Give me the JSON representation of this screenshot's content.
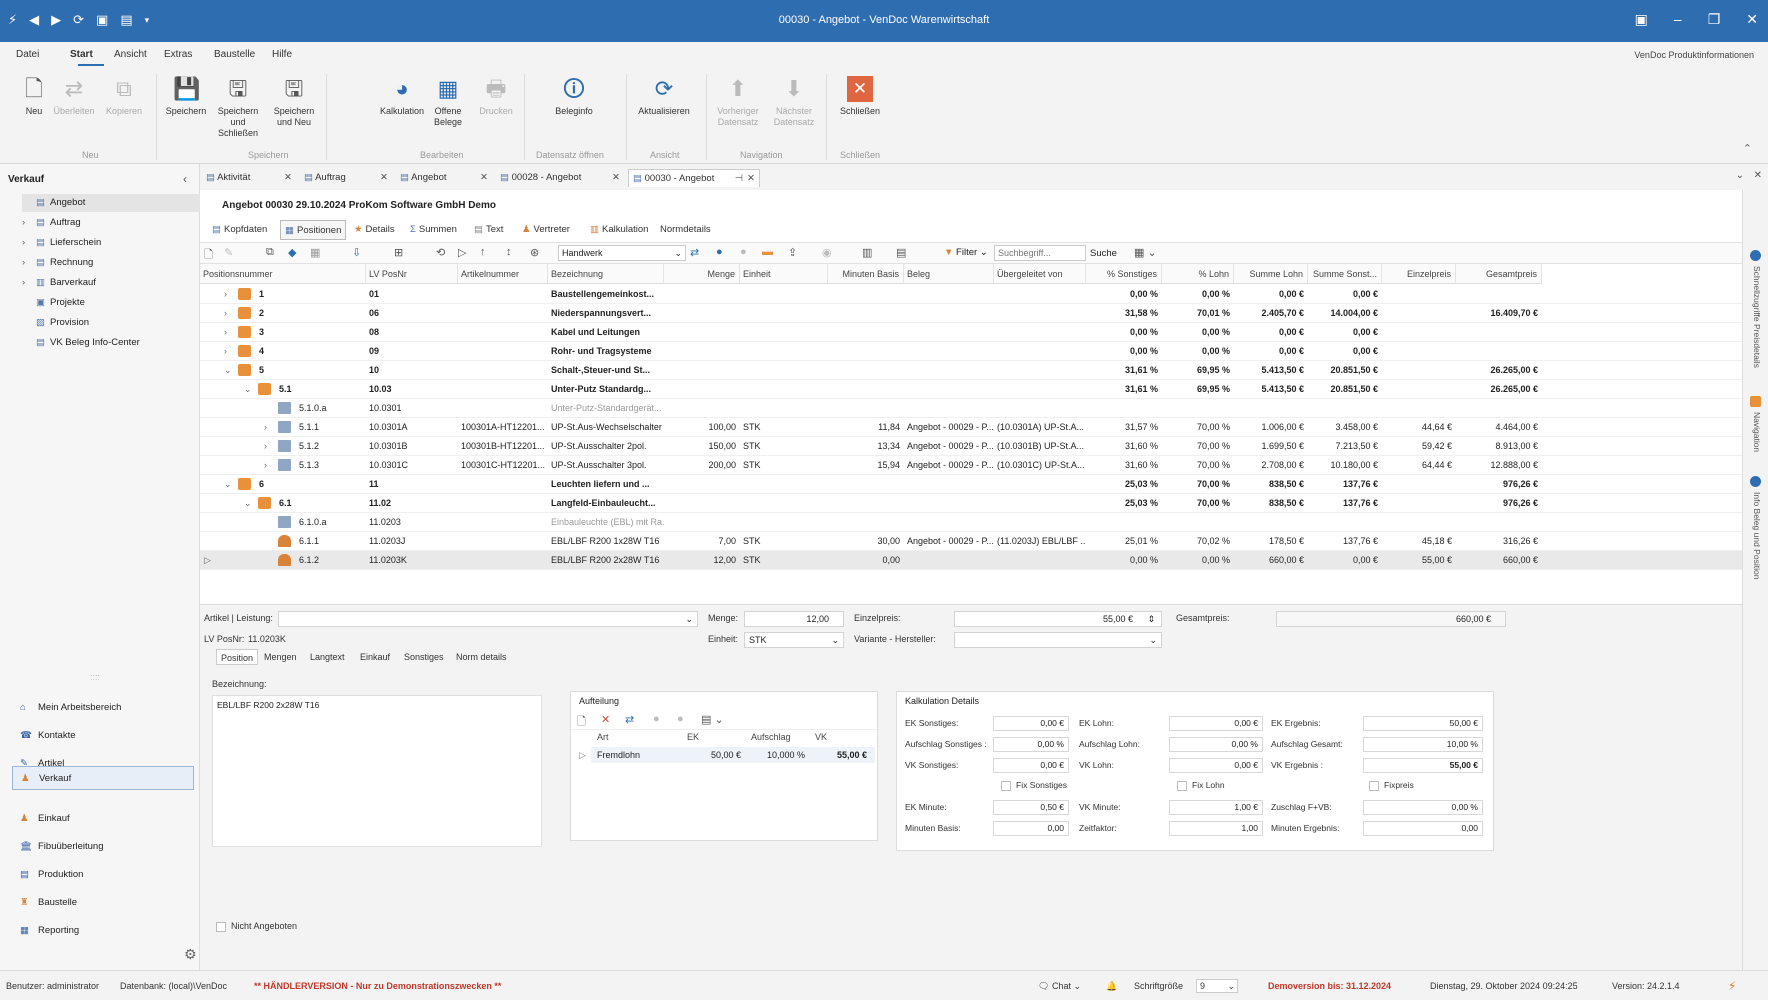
{
  "window": {
    "title": "00030 - Angebot - VenDoc Warenwirtschaft",
    "icons": [
      "app-icon",
      "back-icon",
      "forward-icon",
      "refresh-icon",
      "save-icon",
      "layout-icon",
      "dropdown-icon"
    ],
    "controls": [
      "layout-icon",
      "minimize-icon",
      "restore-icon",
      "close-icon"
    ]
  },
  "menu": {
    "items": [
      "Datei",
      "Start",
      "Ansicht",
      "Extras",
      "Baustelle",
      "Hilfe"
    ],
    "active": "Start",
    "product_info": "VenDoc Produktinformationen"
  },
  "ribbon": {
    "buttons": [
      {
        "label": "Neu",
        "icon": "new-doc-icon",
        "enabled": true
      },
      {
        "label": "Überleiten",
        "icon": "transfer-icon",
        "enabled": false
      },
      {
        "label": "Kopieren",
        "icon": "copy-icon",
        "enabled": false
      },
      {
        "label": "Speichern",
        "icon": "save-icon",
        "enabled": true
      },
      {
        "label": "Speichern und Schließen",
        "icon": "save-close-icon",
        "enabled": true
      },
      {
        "label": "Speichern und Neu",
        "icon": "save-new-icon",
        "enabled": true
      },
      {
        "label": "Kalkulation",
        "icon": "pie-chart-icon",
        "enabled": true
      },
      {
        "label": "Offene Belege",
        "icon": "open-docs-icon",
        "enabled": true
      },
      {
        "label": "Drucken",
        "icon": "print-icon",
        "enabled": false
      },
      {
        "label": "Beleginfo",
        "icon": "info-doc-icon",
        "enabled": true
      },
      {
        "label": "Aktualisieren",
        "icon": "refresh-icon",
        "enabled": true
      },
      {
        "label": "Vorheriger Datensatz",
        "icon": "up-icon",
        "enabled": false
      },
      {
        "label": "Nächster Datensatz",
        "icon": "down-icon",
        "enabled": false
      },
      {
        "label": "Schließen",
        "icon": "close-box-icon",
        "enabled": true
      }
    ],
    "groups": [
      "Neu",
      "Speichern",
      "Bearbeiten",
      "Datensatz öffnen",
      "Ansicht",
      "Navigation",
      "Schließen"
    ]
  },
  "sidebar": {
    "title": "Verkauf",
    "tree": [
      {
        "label": "Angebot",
        "selected": true,
        "expandable": false
      },
      {
        "label": "Auftrag",
        "expandable": true
      },
      {
        "label": "Lieferschein",
        "expandable": true
      },
      {
        "label": "Rechnung",
        "expandable": true
      },
      {
        "label": "Barverkauf",
        "expandable": true
      },
      {
        "label": "Projekte",
        "expandable": false
      },
      {
        "label": "Provision",
        "expandable": false
      },
      {
        "label": "VK Beleg Info-Center",
        "expandable": false
      }
    ],
    "nav": [
      {
        "label": "Mein Arbeitsbereich",
        "icon": "home-icon"
      },
      {
        "label": "Kontakte",
        "icon": "contacts-icon"
      },
      {
        "label": "Artikel",
        "icon": "article-icon"
      },
      {
        "label": "Verkauf",
        "icon": "sales-icon",
        "selected": true
      },
      {
        "label": "Einkauf",
        "icon": "purchase-icon"
      },
      {
        "label": "Fibuüberleitung",
        "icon": "bank-icon"
      },
      {
        "label": "Produktion",
        "icon": "production-icon"
      },
      {
        "label": "Baustelle",
        "icon": "construction-icon"
      },
      {
        "label": "Reporting",
        "icon": "report-icon"
      }
    ]
  },
  "doc_tabs": [
    {
      "label": "Aktivität"
    },
    {
      "label": "Auftrag"
    },
    {
      "label": "Angebot"
    },
    {
      "label": "00028 - Angebot"
    },
    {
      "label": "00030 - Angebot",
      "active": true
    }
  ],
  "document": {
    "header": "Angebot 00030 29.10.2024 ProKom Software GmbH Demo",
    "tabs": [
      "Kopfdaten",
      "Positionen",
      "Details",
      "Summen",
      "Text",
      "Vertreter",
      "Kalkulation",
      "Normdetails"
    ],
    "active_tab": "Positionen",
    "toolbar": {
      "grouping": "Handwerk",
      "filter_label": "Filter",
      "search_placeholder": "Suchbegriff...",
      "search_button": "Suche"
    }
  },
  "grid": {
    "columns": [
      "Positionsnummer",
      "LV PosNr",
      "Artikelnummer",
      "Bezeichnung",
      "Menge",
      "Einheit",
      "Minuten Basis",
      "Beleg",
      "Übergeleitet von",
      "% Sonstiges",
      "% Lohn",
      "Summe Lohn",
      "Summe Sonst...",
      "Einzelpreis",
      "Gesamtpreis"
    ],
    "rows": [
      {
        "level": 0,
        "exp": ">",
        "icon": "folder",
        "bold": true,
        "pos": "1",
        "lv": "01",
        "art": "",
        "bez": "Baustellengemeinkost...",
        "menge": "",
        "einheit": "",
        "min": "",
        "beleg": "",
        "von": "",
        "sonst": "0,00 %",
        "lohn": "0,00 %",
        "slohn": "0,00 €",
        "ssonst": "0,00 €",
        "ep": "",
        "gp": ""
      },
      {
        "level": 0,
        "exp": ">",
        "icon": "folder",
        "bold": true,
        "pos": "2",
        "lv": "06",
        "art": "",
        "bez": "Niederspannungsvert...",
        "menge": "",
        "einheit": "",
        "min": "",
        "beleg": "",
        "von": "",
        "sonst": "31,58 %",
        "lohn": "70,01 %",
        "slohn": "2.405,70 €",
        "ssonst": "14.004,00 €",
        "ep": "",
        "gp": "16.409,70 €"
      },
      {
        "level": 0,
        "exp": ">",
        "icon": "folder",
        "bold": true,
        "pos": "3",
        "lv": "08",
        "art": "",
        "bez": "Kabel und Leitungen",
        "menge": "",
        "einheit": "",
        "min": "",
        "beleg": "",
        "von": "",
        "sonst": "0,00 %",
        "lohn": "0,00 %",
        "slohn": "0,00 €",
        "ssonst": "0,00 €",
        "ep": "",
        "gp": ""
      },
      {
        "level": 0,
        "exp": ">",
        "icon": "folder",
        "bold": true,
        "pos": "4",
        "lv": "09",
        "art": "",
        "bez": "Rohr- und Tragsysteme",
        "menge": "",
        "einheit": "",
        "min": "",
        "beleg": "",
        "von": "",
        "sonst": "0,00 %",
        "lohn": "0,00 %",
        "slohn": "0,00 €",
        "ssonst": "0,00 €",
        "ep": "",
        "gp": ""
      },
      {
        "level": 0,
        "exp": "v",
        "icon": "folder",
        "bold": true,
        "pos": "5",
        "lv": "10",
        "art": "",
        "bez": "Schalt-,Steuer-und St...",
        "menge": "",
        "einheit": "",
        "min": "",
        "beleg": "",
        "von": "",
        "sonst": "31,61 %",
        "lohn": "69,95 %",
        "slohn": "5.413,50 €",
        "ssonst": "20.851,50 €",
        "ep": "",
        "gp": "26.265,00 €"
      },
      {
        "level": 1,
        "exp": "v",
        "icon": "folder",
        "bold": true,
        "pos": "5.1",
        "lv": "10.03",
        "art": "",
        "bez": "Unter-Putz Standardg...",
        "menge": "",
        "einheit": "",
        "min": "",
        "beleg": "",
        "von": "",
        "sonst": "31,61 %",
        "lohn": "69,95 %",
        "slohn": "5.413,50 €",
        "ssonst": "20.851,50 €",
        "ep": "",
        "gp": "26.265,00 €"
      },
      {
        "level": 2,
        "exp": "",
        "icon": "item",
        "muted": true,
        "pos": "5.1.0.a",
        "lv": "10.0301",
        "art": "",
        "bez": "Unter-Putz-Standardgerät...",
        "menge": "",
        "einheit": "",
        "min": "",
        "beleg": "",
        "von": "",
        "sonst": "",
        "lohn": "",
        "slohn": "",
        "ssonst": "",
        "ep": "",
        "gp": ""
      },
      {
        "level": 2,
        "exp": ">",
        "icon": "item",
        "pos": "5.1.1",
        "lv": "10.0301A",
        "art": "100301A-HT12201...",
        "bez": "UP-St.Aus-Wechselschalter",
        "menge": "100,00",
        "einheit": "STK",
        "min": "11,84",
        "beleg": "Angebot - 00029 - P...",
        "von": "(10.0301A) UP-St.A...",
        "sonst": "31,57 %",
        "lohn": "70,00 %",
        "slohn": "1.006,00 €",
        "ssonst": "3.458,00 €",
        "ep": "44,64 €",
        "gp": "4.464,00 €"
      },
      {
        "level": 2,
        "exp": ">",
        "icon": "item",
        "pos": "5.1.2",
        "lv": "10.0301B",
        "art": "100301B-HT12201...",
        "bez": "UP-St.Ausschalter 2pol.",
        "menge": "150,00",
        "einheit": "STK",
        "min": "13,34",
        "beleg": "Angebot - 00029 - P...",
        "von": "(10.0301B) UP-St.A...",
        "sonst": "31,60 %",
        "lohn": "70,00 %",
        "slohn": "1.699,50 €",
        "ssonst": "7.213,50 €",
        "ep": "59,42 €",
        "gp": "8.913,00 €"
      },
      {
        "level": 2,
        "exp": ">",
        "icon": "item",
        "pos": "5.1.3",
        "lv": "10.0301C",
        "art": "100301C-HT12201...",
        "bez": "UP-St.Ausschalter 3pol.",
        "menge": "200,00",
        "einheit": "STK",
        "min": "15,94",
        "beleg": "Angebot - 00029 - P...",
        "von": "(10.0301C) UP-St.A...",
        "sonst": "31,60 %",
        "lohn": "70,00 %",
        "slohn": "2.708,00 €",
        "ssonst": "10.180,00 €",
        "ep": "64,44 €",
        "gp": "12.888,00 €"
      },
      {
        "level": 0,
        "exp": "v",
        "icon": "folder",
        "bold": true,
        "pos": "6",
        "lv": "11",
        "art": "",
        "bez": "Leuchten liefern und ...",
        "menge": "",
        "einheit": "",
        "min": "",
        "beleg": "",
        "von": "",
        "sonst": "25,03 %",
        "lohn": "70,00 %",
        "slohn": "838,50 €",
        "ssonst": "137,76 €",
        "ep": "",
        "gp": "976,26 €"
      },
      {
        "level": 1,
        "exp": "v",
        "icon": "folder",
        "bold": true,
        "pos": "6.1",
        "lv": "11.02",
        "art": "",
        "bez": "Langfeld-Einbauleucht...",
        "menge": "",
        "einheit": "",
        "min": "",
        "beleg": "",
        "von": "",
        "sonst": "25,03 %",
        "lohn": "70,00 %",
        "slohn": "838,50 €",
        "ssonst": "137,76 €",
        "ep": "",
        "gp": "976,26 €"
      },
      {
        "level": 2,
        "exp": "",
        "icon": "item",
        "muted": true,
        "pos": "6.1.0.a",
        "lv": "11.0203",
        "art": "",
        "bez": "Einbauleuchte (EBL) mit Ra...",
        "menge": "",
        "einheit": "",
        "min": "",
        "beleg": "",
        "von": "",
        "sonst": "",
        "lohn": "",
        "slohn": "",
        "ssonst": "",
        "ep": "",
        "gp": ""
      },
      {
        "level": 2,
        "exp": "",
        "icon": "person",
        "pos": "6.1.1",
        "lv": "11.0203J",
        "art": "",
        "bez": "EBL/LBF R200 1x28W T16",
        "menge": "7,00",
        "einheit": "STK",
        "min": "30,00",
        "beleg": "Angebot - 00029 - P...",
        "von": "(11.0203J) EBL/LBF ...",
        "sonst": "25,01 %",
        "lohn": "70,02 %",
        "slohn": "178,50 €",
        "ssonst": "137,76 €",
        "ep": "45,18 €",
        "gp": "316,26 €"
      },
      {
        "level": 2,
        "exp": "",
        "icon": "person",
        "selected": true,
        "pos": "6.1.2",
        "lv": "11.0203K",
        "art": "",
        "bez": "EBL/LBF R200 2x28W T16",
        "menge": "12,00",
        "einheit": "STK",
        "min": "0,00",
        "beleg": "",
        "von": "",
        "sonst": "0,00 %",
        "lohn": "0,00 %",
        "slohn": "660,00 €",
        "ssonst": "0,00 €",
        "ep": "55,00 €",
        "gp": "660,00 €"
      }
    ]
  },
  "detail": {
    "artikel_label": "Artikel | Leistung:",
    "artikel_value": "",
    "menge_label": "Menge:",
    "menge_value": "12,00",
    "einzelpreis_label": "Einzelpreis:",
    "einzelpreis_value": "55,00 €",
    "gesamtpreis_label": "Gesamtpreis:",
    "gesamtpreis_value": "660,00 €",
    "lvposnr_label": "LV PosNr:",
    "lvposnr_value": "11.0203K",
    "einheit_label": "Einheit:",
    "einheit_value": "STK",
    "variante_label": "Variante - Hersteller:",
    "variante_value": "",
    "tabs": [
      "Position",
      "Mengen",
      "Langtext",
      "Einkauf",
      "Sonstiges",
      "Norm details"
    ],
    "active_tab": "Position",
    "bezeichnung_label": "Bezeichnung:",
    "bezeichnung_value": "EBL/LBF R200 2x28W T16",
    "nicht_angeboten": "Nicht Angeboten",
    "aufteilung": {
      "title": "Aufteilung",
      "columns": [
        "Art",
        "EK",
        "Aufschlag",
        "VK"
      ],
      "rows": [
        {
          "art": "Fremdlohn",
          "ek": "50,00 €",
          "aufschlag": "10,000 %",
          "vk": "55,00 €"
        }
      ]
    },
    "kalkulation": {
      "title": "Kalkulation Details",
      "col1": [
        {
          "label": "EK Sonstiges:",
          "value": "0,00 €"
        },
        {
          "label": "Aufschlag Sonstiges :",
          "value": "0,00 %"
        },
        {
          "label": "VK Sonstiges:",
          "value": "0,00 €"
        },
        {
          "label": "EK Minute:",
          "value": "0,50 €"
        },
        {
          "label": "Minuten Basis:",
          "value": "0,00"
        }
      ],
      "col2": [
        {
          "label": "EK Lohn:",
          "value": "0,00 €"
        },
        {
          "label": "Aufschlag Lohn:",
          "value": "0,00 %"
        },
        {
          "label": "VK Lohn:",
          "value": "0,00 €"
        },
        {
          "label": "VK Minute:",
          "value": "1,00 €"
        },
        {
          "label": "Zeitfaktor:",
          "value": "1,00"
        }
      ],
      "col3": [
        {
          "label": "EK Ergebnis:",
          "value": "50,00 €"
        },
        {
          "label": "Aufschlag Gesamt:",
          "value": "10,00 %"
        },
        {
          "label": "VK Ergebnis :",
          "value": "55,00 €"
        },
        {
          "label": "Zuschlag F+VB:",
          "value": "0,00 %"
        },
        {
          "label": "Minuten Ergebnis:",
          "value": "0,00"
        }
      ],
      "checks": [
        "Fix Sonstiges",
        "Fix Lohn",
        "Fixpreis"
      ]
    }
  },
  "right_rail": [
    "Schnellzugriffe Preisdetails",
    "Navigation",
    "Info Beleg und Position"
  ],
  "status": {
    "user": "Benutzer: administrator",
    "db": "Datenbank: (local)\\VenDoc",
    "version_note": "** HÄNDLERVERSION - Nur zu Demonstrationszwecken **",
    "chat": "Chat",
    "font_size_label": "Schriftgröße",
    "font_size_value": "9",
    "demo": "Demoversion bis: 31.12.2024",
    "date": "Dienstag, 29. Oktober 2024 09:24:25",
    "version": "Version: 24.2.1.4"
  },
  "colors": {
    "accent": "#2f6db1",
    "folder": "#e8913a",
    "warning": "#c0392b"
  }
}
